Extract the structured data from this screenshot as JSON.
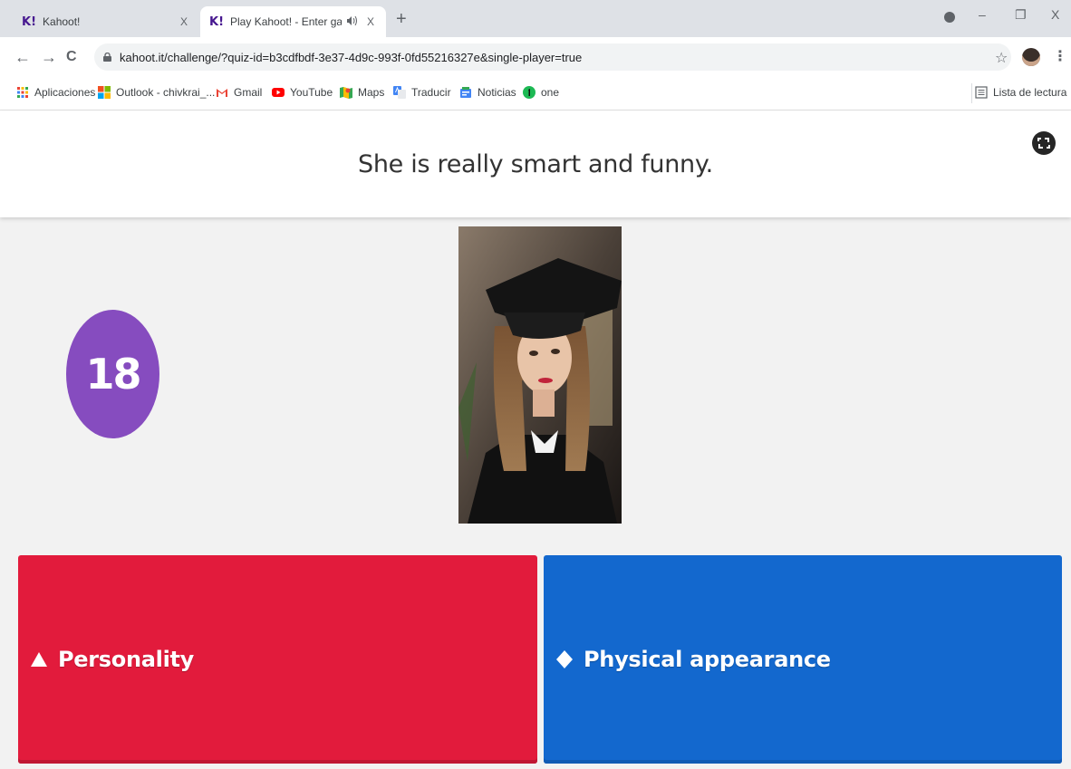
{
  "browser": {
    "tabs": [
      {
        "title": "Kahoot!",
        "close": "X"
      },
      {
        "title": "Play Kahoot! - Enter game PI",
        "close": "X"
      }
    ],
    "new_tab": "+",
    "window_controls": {
      "minimize": "–",
      "restore": "❐",
      "close": "X"
    },
    "nav": {
      "back": "←",
      "forward": "→",
      "reload": "C"
    },
    "url": "kahoot.it/challenge/?quiz-id=b3cdfbdf-3e37-4d9c-993f-0fd55216327e&single-player=true",
    "star": "☆",
    "menu": "⋮",
    "bookmarks": [
      {
        "label": "Aplicaciones",
        "icon": "apps-grid-icon"
      },
      {
        "label": "Outlook - chivkrai_...",
        "icon": "outlook-icon"
      },
      {
        "label": "Gmail",
        "icon": "gmail-icon"
      },
      {
        "label": "YouTube",
        "icon": "youtube-icon"
      },
      {
        "label": "Maps",
        "icon": "maps-icon"
      },
      {
        "label": "Traducir",
        "icon": "translate-icon"
      },
      {
        "label": "Noticias",
        "icon": "news-icon"
      },
      {
        "label": "one",
        "icon": "one-icon"
      }
    ],
    "reading_list": "Lista de lectura"
  },
  "game": {
    "question": "She is really smart and funny.",
    "timer": "18",
    "image": "graduate-portrait",
    "answers": [
      {
        "label": "Personality",
        "shape": "triangle-icon",
        "color": "#e21b3c"
      },
      {
        "label": "Physical appearance",
        "shape": "diamond-icon",
        "color": "#1368ce"
      }
    ]
  },
  "colors": {
    "timer": "#864cbf",
    "kahoot_brand": "#46178f",
    "background": "#f2f2f2"
  }
}
